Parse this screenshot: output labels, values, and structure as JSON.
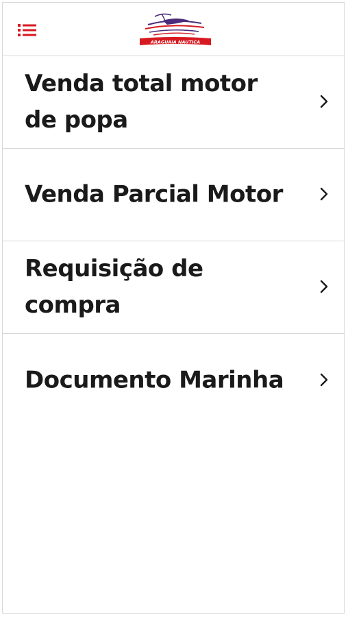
{
  "header": {
    "menu_icon": "hamburger-list-icon",
    "logo_text": "ARAGUAIA NAUTICA",
    "logo_color": "#d71920",
    "logo_accent": "#4b2c7a"
  },
  "menu": {
    "items": [
      {
        "label": "Venda total motor de popa",
        "icon": "chevron-right-icon"
      },
      {
        "label": "Venda Parcial Motor",
        "icon": "chevron-right-icon"
      },
      {
        "label": "Requisição de compra",
        "icon": "chevron-right-icon"
      },
      {
        "label": "Documento Marinha",
        "icon": "chevron-right-icon"
      }
    ]
  },
  "colors": {
    "accent": "#d71920",
    "text": "#1a1a1a",
    "divider": "#d9d9d9"
  }
}
